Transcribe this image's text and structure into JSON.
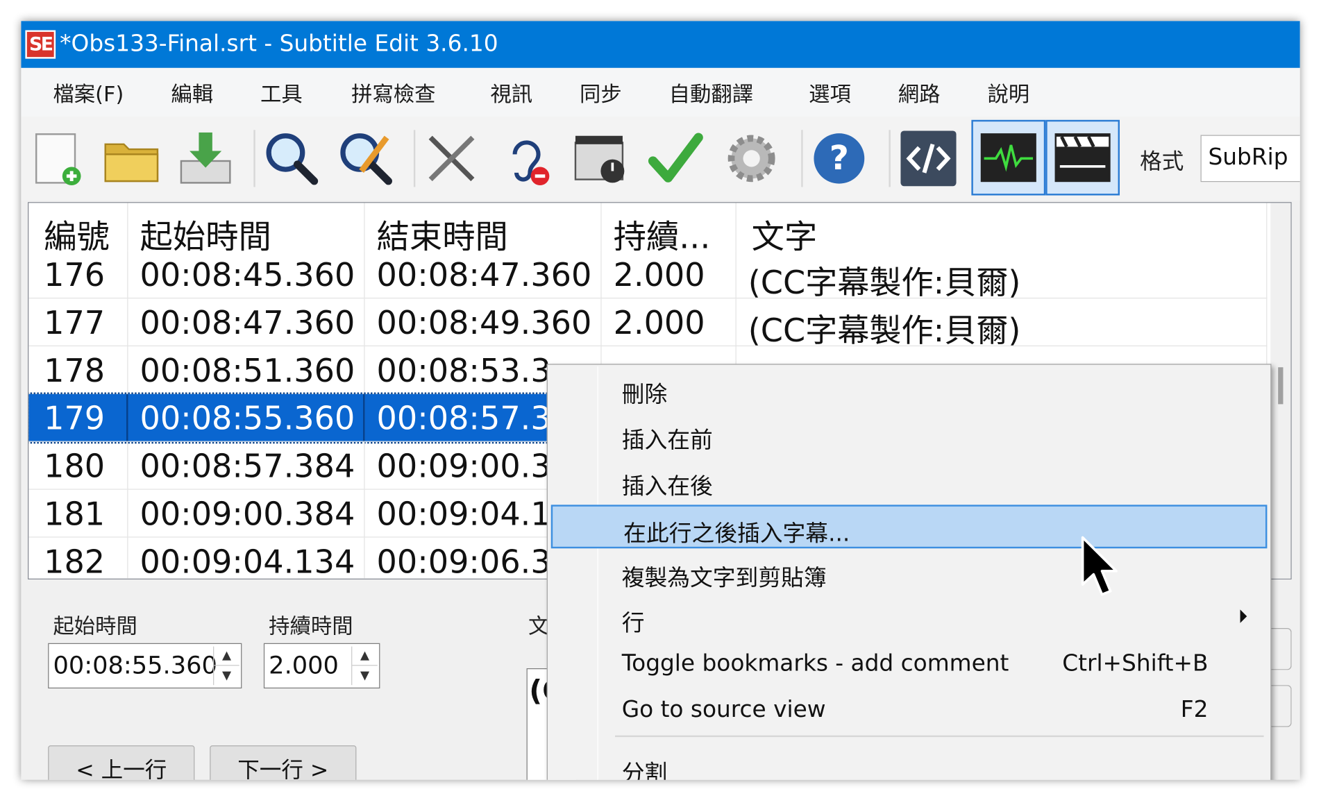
{
  "window": {
    "title": "*Obs133-Final.srt - Subtitle Edit 3.6.10",
    "logo_text": "SE"
  },
  "menubar": [
    "檔案(F)",
    "編輯",
    "工具",
    "拼寫檢查",
    "視訊",
    "同步",
    "自動翻譯",
    "選項",
    "網路",
    "說明"
  ],
  "toolbar": {
    "icons": [
      "new-file-icon",
      "open-folder-icon",
      "download-save-icon",
      "search-icon",
      "replace-icon",
      "tools-icon",
      "ear-icon",
      "video-clock-icon",
      "check-icon",
      "settings-gear-icon",
      "help-icon",
      "source-code-icon",
      "waveform-icon",
      "video-clapper-icon"
    ],
    "format_label": "格式",
    "format_value": "SubRip"
  },
  "grid": {
    "columns": [
      "編號",
      "起始時間",
      "結束時間",
      "持續...",
      "文字"
    ],
    "rows": [
      {
        "num": "176",
        "start": "00:08:45.360",
        "end": "00:08:47.360",
        "duration": "2.000",
        "text": "(CC字幕製作:貝爾)"
      },
      {
        "num": "177",
        "start": "00:08:47.360",
        "end": "00:08:49.360",
        "duration": "2.000",
        "text": "(CC字幕製作:貝爾)"
      },
      {
        "num": "178",
        "start": "00:08:51.360",
        "end": "00:08:53.3",
        "duration": "",
        "text": ""
      },
      {
        "num": "179",
        "start": "00:08:55.360",
        "end": "00:08:57.3",
        "duration": "",
        "text": ""
      },
      {
        "num": "180",
        "start": "00:08:57.384",
        "end": "00:09:00.3",
        "duration": "",
        "text": ""
      },
      {
        "num": "181",
        "start": "00:09:00.384",
        "end": "00:09:04.1",
        "duration": "",
        "text": ""
      },
      {
        "num": "182",
        "start": "00:09:04.134",
        "end": "00:09:06.3",
        "duration": "",
        "text": ""
      }
    ],
    "selected_row": "179"
  },
  "edit_panel": {
    "start_label": "起始時間",
    "start_value": "00:08:55.360",
    "duration_label": "持續時間",
    "duration_value": "2.000",
    "text_label": "文",
    "text_value": "(C",
    "prev_button": "< 上一行",
    "next_button": "下一行 >"
  },
  "context_menu": {
    "items": [
      {
        "label": "刪除",
        "shortcut": ""
      },
      {
        "label": "插入在前",
        "shortcut": ""
      },
      {
        "label": "插入在後",
        "shortcut": ""
      },
      {
        "label": "在此行之後插入字幕...",
        "shortcut": "",
        "highlighted": true
      },
      {
        "label": "複製為文字到剪貼簿",
        "shortcut": ""
      },
      {
        "label": "行",
        "shortcut": "",
        "submenu": true
      },
      {
        "label": "Toggle bookmarks - add comment",
        "shortcut": "Ctrl+Shift+B"
      },
      {
        "label": "Go to source view",
        "shortcut": "F2"
      },
      {
        "label": "分割",
        "shortcut": ""
      }
    ]
  },
  "colors": {
    "titlebar": "#0078d7",
    "selection": "#0a66d0",
    "menu_highlight": "#b9d7f5"
  }
}
